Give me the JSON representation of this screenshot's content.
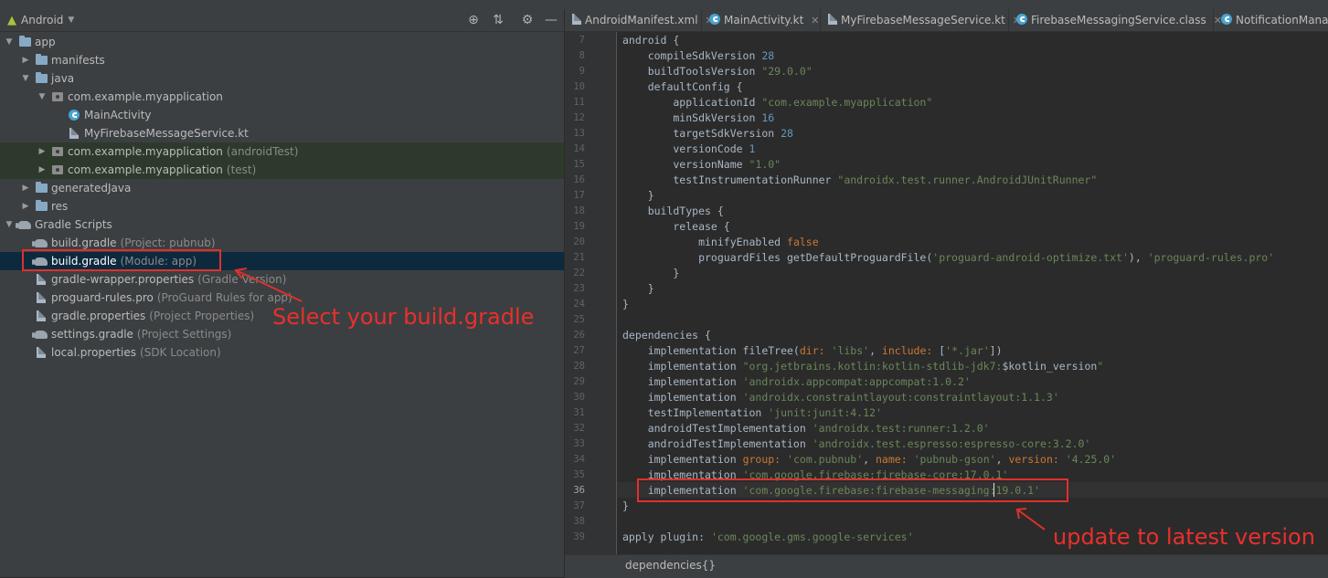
{
  "project_panel": {
    "view_selector": "Android",
    "tree": [
      {
        "label": "app",
        "hint": "",
        "level": 0,
        "expanded": true,
        "icon": "app-folder-icon"
      },
      {
        "label": "manifests",
        "hint": "",
        "level": 1,
        "expanded": false,
        "icon": "folder-icon"
      },
      {
        "label": "java",
        "hint": "",
        "level": 1,
        "expanded": true,
        "icon": "folder-icon"
      },
      {
        "label": "com.example.myapplication",
        "hint": "",
        "level": 2,
        "expanded": true,
        "icon": "package-icon"
      },
      {
        "label": "MainActivity",
        "hint": "",
        "level": 3,
        "expanded": null,
        "icon": "kotlin-class-icon"
      },
      {
        "label": "MyFirebaseMessageService.kt",
        "hint": "",
        "level": 3,
        "expanded": null,
        "icon": "kotlin-file-icon"
      },
      {
        "label": "com.example.myapplication",
        "hint": "(androidTest)",
        "level": 2,
        "expanded": false,
        "icon": "package-icon"
      },
      {
        "label": "com.example.myapplication",
        "hint": "(test)",
        "level": 2,
        "expanded": false,
        "icon": "package-icon"
      },
      {
        "label": "generatedJava",
        "hint": "",
        "level": 1,
        "expanded": false,
        "icon": "folder-icon"
      },
      {
        "label": "res",
        "hint": "",
        "level": 1,
        "expanded": false,
        "icon": "folder-icon"
      },
      {
        "label": "Gradle Scripts",
        "hint": "",
        "level": 0,
        "expanded": true,
        "icon": "gradle-icon"
      },
      {
        "label": "build.gradle",
        "hint": "(Project: pubnub)",
        "level": 1,
        "expanded": null,
        "icon": "gradle-icon"
      },
      {
        "label": "build.gradle",
        "hint": "(Module: app)",
        "level": 1,
        "expanded": null,
        "icon": "gradle-icon"
      },
      {
        "label": "gradle-wrapper.properties",
        "hint": "(Gradle Version)",
        "level": 1,
        "expanded": null,
        "icon": "properties-icon"
      },
      {
        "label": "proguard-rules.pro",
        "hint": "(ProGuard Rules for app)",
        "level": 1,
        "expanded": null,
        "icon": "file-icon"
      },
      {
        "label": "gradle.properties",
        "hint": "(Project Properties)",
        "level": 1,
        "expanded": null,
        "icon": "properties-icon"
      },
      {
        "label": "settings.gradle",
        "hint": "(Project Settings)",
        "level": 1,
        "expanded": null,
        "icon": "gradle-icon"
      },
      {
        "label": "local.properties",
        "hint": "(SDK Location)",
        "level": 1,
        "expanded": null,
        "icon": "properties-icon"
      }
    ],
    "selected_index": 12,
    "annotation": "Select your build.gradle"
  },
  "tabs": [
    {
      "label": "AndroidManifest.xml"
    },
    {
      "label": "MainActivity.kt"
    },
    {
      "label": "MyFirebaseMessageService.kt"
    },
    {
      "label": "FirebaseMessagingService.class"
    },
    {
      "label": "NotificationManage"
    }
  ],
  "editor": {
    "lines": [
      {
        "no": "7",
        "text": "android {"
      },
      {
        "no": "8",
        "text": "    compileSdkVersion 28"
      },
      {
        "no": "9",
        "text": "    buildToolsVersion \"29.0.0\""
      },
      {
        "no": "10",
        "text": "    defaultConfig {"
      },
      {
        "no": "11",
        "text": "        applicationId \"com.example.myapplication\""
      },
      {
        "no": "12",
        "text": "        minSdkVersion 16"
      },
      {
        "no": "13",
        "text": "        targetSdkVersion 28"
      },
      {
        "no": "14",
        "text": "        versionCode 1"
      },
      {
        "no": "15",
        "text": "        versionName \"1.0\""
      },
      {
        "no": "16",
        "text": "        testInstrumentationRunner \"androidx.test.runner.AndroidJUnitRunner\""
      },
      {
        "no": "17",
        "text": "    }"
      },
      {
        "no": "18",
        "text": "    buildTypes {"
      },
      {
        "no": "19",
        "text": "        release {"
      },
      {
        "no": "20",
        "text": "            minifyEnabled false"
      },
      {
        "no": "21",
        "text": "            proguardFiles getDefaultProguardFile('proguard-android-optimize.txt'), 'proguard-rules.pro'"
      },
      {
        "no": "22",
        "text": "        }"
      },
      {
        "no": "23",
        "text": "    }"
      },
      {
        "no": "24",
        "text": "}"
      },
      {
        "no": "25",
        "text": ""
      },
      {
        "no": "26",
        "text": "dependencies {"
      },
      {
        "no": "27",
        "text": "    implementation fileTree(dir: 'libs', include: ['*.jar'])"
      },
      {
        "no": "28",
        "text": "    implementation \"org.jetbrains.kotlin:kotlin-stdlib-jdk7:$kotlin_version\""
      },
      {
        "no": "29",
        "text": "    implementation 'androidx.appcompat:appcompat:1.0.2'"
      },
      {
        "no": "30",
        "text": "    implementation 'androidx.constraintlayout:constraintlayout:1.1.3'"
      },
      {
        "no": "31",
        "text": "    testImplementation 'junit:junit:4.12'"
      },
      {
        "no": "32",
        "text": "    androidTestImplementation 'androidx.test:runner:1.2.0'"
      },
      {
        "no": "33",
        "text": "    androidTestImplementation 'androidx.test.espresso:espresso-core:3.2.0'"
      },
      {
        "no": "34",
        "text": "    implementation group: 'com.pubnub', name: 'pubnub-gson', version: '4.25.0'"
      },
      {
        "no": "35",
        "text": "    implementation 'com.google.firebase:firebase-core:17.0.1'"
      },
      {
        "no": "36",
        "text": "    implementation 'com.google.firebase:firebase-messaging:19.0.1'"
      },
      {
        "no": "37",
        "text": "}"
      },
      {
        "no": "38",
        "text": ""
      },
      {
        "no": "39",
        "text": "apply plugin: 'com.google.gms.google-services'"
      }
    ],
    "current_line": "36",
    "annotation": "update to latest version"
  },
  "status": {
    "breadcrumb": "dependencies{}"
  },
  "colors": {
    "annotation": "#e8302c",
    "string": "#6a8759",
    "number": "#6897bb",
    "keyword": "#cc7832",
    "selection": "#0d293e"
  }
}
